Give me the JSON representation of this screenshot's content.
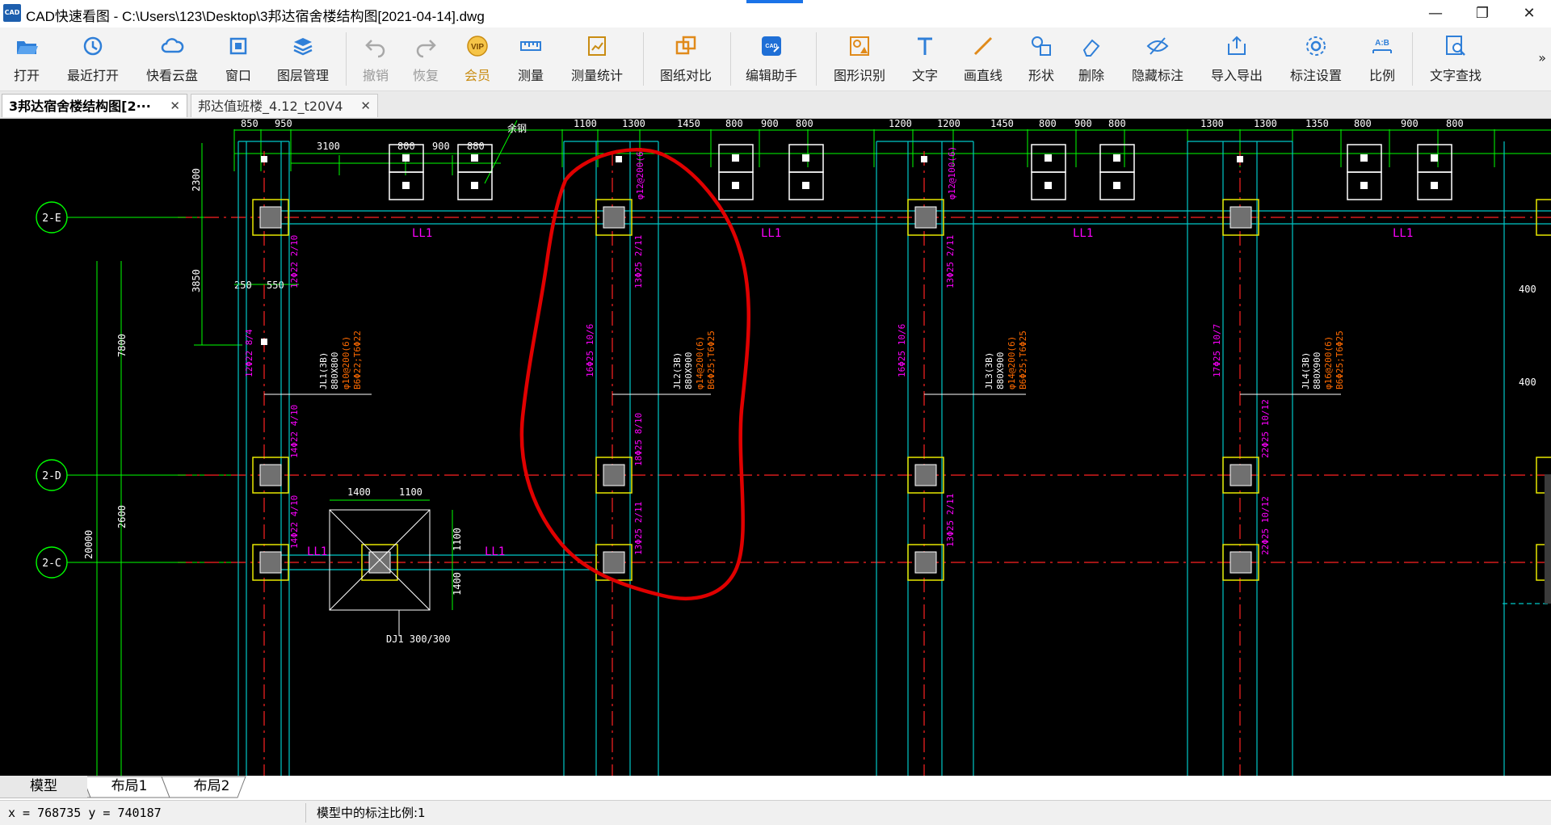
{
  "window": {
    "title": "CAD快速看图 - C:\\Users\\123\\Desktop\\3邦达宿舍楼结构图[2021-04-14].dwg",
    "logo_text": "CAD",
    "controls": {
      "minimize": "—",
      "restore": "❐",
      "close": "✕"
    }
  },
  "toolbar": {
    "items": [
      {
        "id": "open",
        "label": "打开",
        "icon": "folder-open-icon",
        "enabled": true
      },
      {
        "id": "recent",
        "label": "最近打开",
        "icon": "clock-icon",
        "enabled": true
      },
      {
        "id": "cloud",
        "label": "快看云盘",
        "icon": "cloud-icon",
        "enabled": true
      },
      {
        "id": "window",
        "label": "窗口",
        "icon": "window-icon",
        "enabled": true
      },
      {
        "id": "layers",
        "label": "图层管理",
        "icon": "layers-icon",
        "enabled": true
      },
      {
        "id": "undo",
        "label": "撤销",
        "icon": "undo-icon",
        "enabled": false
      },
      {
        "id": "redo",
        "label": "恢复",
        "icon": "redo-icon",
        "enabled": false
      },
      {
        "id": "vip",
        "label": "会员",
        "icon": "vip-icon",
        "enabled": true
      },
      {
        "id": "measure",
        "label": "测量",
        "icon": "ruler-icon",
        "enabled": true
      },
      {
        "id": "measure-stats",
        "label": "测量统计",
        "icon": "measure-stats-icon",
        "enabled": true
      },
      {
        "id": "compare",
        "label": "图纸对比",
        "icon": "compare-icon",
        "enabled": true
      },
      {
        "id": "edit-assistant",
        "label": "编辑助手",
        "icon": "cad-edit-icon",
        "enabled": true
      },
      {
        "id": "shape-recognize",
        "label": "图形识别",
        "icon": "shape-recognize-icon",
        "enabled": true
      },
      {
        "id": "text",
        "label": "文字",
        "icon": "text-icon",
        "enabled": true
      },
      {
        "id": "line",
        "label": "画直线",
        "icon": "line-icon",
        "enabled": true
      },
      {
        "id": "shape",
        "label": "形状",
        "icon": "shape-icon",
        "enabled": true
      },
      {
        "id": "delete",
        "label": "删除",
        "icon": "eraser-icon",
        "enabled": true
      },
      {
        "id": "hide-annotation",
        "label": "隐藏标注",
        "icon": "eye-hidden-icon",
        "enabled": true
      },
      {
        "id": "import-export",
        "label": "导入导出",
        "icon": "export-icon",
        "enabled": true
      },
      {
        "id": "annotation-settings",
        "label": "标注设置",
        "icon": "settings-icon",
        "enabled": true
      },
      {
        "id": "ratio",
        "label": "比例",
        "icon": "ratio-icon",
        "enabled": true
      },
      {
        "id": "text-search",
        "label": "文字查找",
        "icon": "search-text-icon",
        "enabled": true
      }
    ],
    "more": "»"
  },
  "tabs": [
    {
      "label": "3邦达宿舍楼结构图[2···",
      "active": true
    },
    {
      "label": "邦达值班楼_4.12_t20V4",
      "active": false
    }
  ],
  "drawing": {
    "grid_axes": [
      "2-E",
      "2-D",
      "2-C"
    ],
    "beam_labels": [
      "LL1",
      "LL1",
      "LL1",
      "LL1",
      "LL1",
      "LL1"
    ],
    "top_dims": [
      "850",
      "950",
      "1100",
      "1300",
      "1450",
      "800",
      "900",
      "800",
      "1200",
      "1200",
      "1450",
      "800",
      "900",
      "800",
      "1300",
      "1300",
      "1350",
      "800",
      "900",
      "800"
    ],
    "top_dims_row2": [
      "3100",
      "800",
      "900",
      "880"
    ],
    "left_dims": [
      "2300",
      "3850",
      "7800",
      "2600",
      "20000"
    ],
    "misc_dims": [
      "250",
      "550",
      "1400",
      "1100",
      "1100",
      "1400",
      "400",
      "400"
    ],
    "joist_labels": [
      {
        "name": "JL1(3B)",
        "size": "880X800",
        "rebar": "φ10@200(6)",
        "bottom": "B6Φ22;T6Φ22"
      },
      {
        "name": "JL2(3B)",
        "size": "880X900",
        "rebar": "φ14@200(6)",
        "bottom": "B6Φ25;T6Φ25"
      },
      {
        "name": "JL3(3B)",
        "size": "880X900",
        "rebar": "φ14@200(6)",
        "bottom": "B6Φ25;T6Φ25"
      },
      {
        "name": "JL4(3B)",
        "size": "880X900",
        "rebar": "φ16@200(6)",
        "bottom": "B6Φ25;T6Φ25"
      }
    ],
    "rebar_notes": [
      "12Φ22 2/10",
      "12Φ22 8/4",
      "14Φ22 4/10",
      "14Φ22 4/10",
      "16Φ25 10/6",
      "18Φ25 8/10",
      "13Φ25 2/11",
      "13Φ25 2/11",
      "16Φ25 10/6",
      "13Φ25 2/11",
      "13Φ25 2/11",
      "17Φ25 10/7",
      "22Φ25 10/12",
      "22Φ25 10/12",
      "φ12@200(6)",
      "φ12@100(6)"
    ],
    "note": "DJ1 300/300",
    "tag": "余钢"
  },
  "layout_tabs": [
    {
      "label": "模型",
      "active": true
    },
    {
      "label": "布局1",
      "active": false
    },
    {
      "label": "布局2",
      "active": false
    }
  ],
  "status": {
    "coords": "x = 768735  y = 740187",
    "scale": "模型中的标注比例:1"
  },
  "colors": {
    "canvas_bg": "#000000",
    "grid_green": "#00ff00",
    "column_cyan": "#00c8c8",
    "axis_red": "#ff2222",
    "column_yellow": "#e8e800",
    "text_magenta": "#ff00ff",
    "text_orange": "#ff6a00",
    "markup_red": "#e00000"
  }
}
